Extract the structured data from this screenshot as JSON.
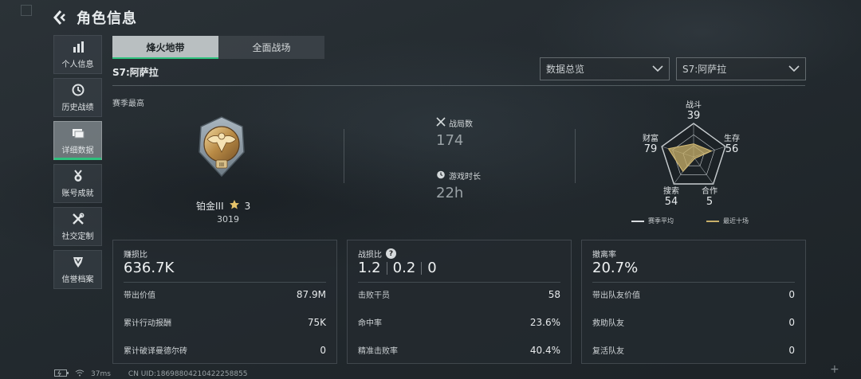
{
  "header": {
    "title": "角色信息"
  },
  "sidebar": {
    "items": [
      {
        "label": "个人信息",
        "icon": "bar-chart-icon"
      },
      {
        "label": "历史战绩",
        "icon": "history-clock-icon"
      },
      {
        "label": "详细数据",
        "icon": "folder-data-icon",
        "active": true
      },
      {
        "label": "账号成就",
        "icon": "medal-icon"
      },
      {
        "label": "社交定制",
        "icon": "tools-icon"
      },
      {
        "label": "信誉档案",
        "icon": "shield-icon"
      }
    ]
  },
  "tabs": [
    {
      "label": "烽火地带",
      "active": true
    },
    {
      "label": "全面战场",
      "active": false
    }
  ],
  "season": {
    "name": "S7:阿萨拉",
    "section_label": "赛季最高"
  },
  "filters": {
    "view": "数据总览",
    "season": "S7:阿萨拉"
  },
  "rank": {
    "name": "铂金III",
    "stars": "3",
    "points": "3019",
    "medal_tier": "III"
  },
  "match_stats": {
    "matches_label": "战局数",
    "matches_value": "174",
    "playtime_label": "游戏时长",
    "playtime_value": "22h"
  },
  "radar": {
    "axes": [
      {
        "label": "战斗",
        "value": "39"
      },
      {
        "label": "生存",
        "value": "56"
      },
      {
        "label": "合作",
        "value": "5"
      },
      {
        "label": "搜索",
        "value": "54"
      },
      {
        "label": "财富",
        "value": "79"
      }
    ],
    "legend": [
      {
        "label": "赛季平均",
        "color": "#d8dcdf"
      },
      {
        "label": "最近十场",
        "color": "#c8b06a"
      }
    ]
  },
  "cards": [
    {
      "title": "赚损比",
      "big": "636.7K",
      "rows": [
        {
          "label": "带出价值",
          "value": "87.9M"
        },
        {
          "label": "累计行动报酬",
          "value": "75K"
        },
        {
          "label": "累计破译曼德尔砖",
          "value": "0"
        }
      ]
    },
    {
      "title": "战损比",
      "ratios": [
        "1.2",
        "0.2",
        "0"
      ],
      "help": "?",
      "rows": [
        {
          "label": "击败干员",
          "value": "58"
        },
        {
          "label": "命中率",
          "value": "23.6%"
        },
        {
          "label": "精准击败率",
          "value": "40.4%"
        }
      ]
    },
    {
      "title": "撤离率",
      "big": "20.7%",
      "rows": [
        {
          "label": "带出队友价值",
          "value": "0"
        },
        {
          "label": "救助队友",
          "value": "0"
        },
        {
          "label": "复活队友",
          "value": "0"
        }
      ]
    }
  ],
  "footer": {
    "ping": "37ms",
    "uid": "CN UID:18698804210422258855"
  },
  "colors": {
    "accent": "#2ec27e",
    "gold": "#c8b06a"
  }
}
